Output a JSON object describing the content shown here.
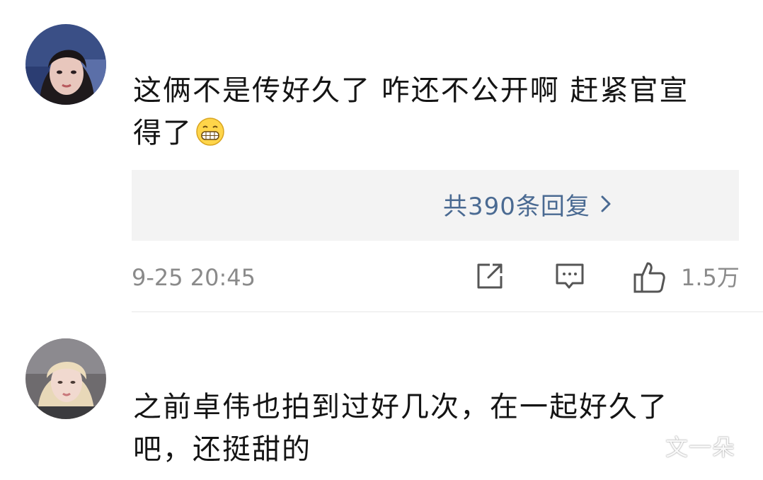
{
  "comments": [
    {
      "text_line1": "这俩不是传好久了 咋还不公开啊 赶紧官宣",
      "text_line2": "得了",
      "emoji": "grinning-emoji",
      "replies_label": "共390条回复",
      "timestamp": "9-25 20:45",
      "like_count": "1.5万"
    },
    {
      "text_line1": "之前卓伟也拍到过好几次，在一起好久了",
      "text_line2": "吧，还挺甜的"
    }
  ],
  "watermark": "文一朵",
  "colors": {
    "link": "#4a6a92",
    "meta": "#8a8a8a",
    "reply_box_bg": "#f3f3f3"
  }
}
